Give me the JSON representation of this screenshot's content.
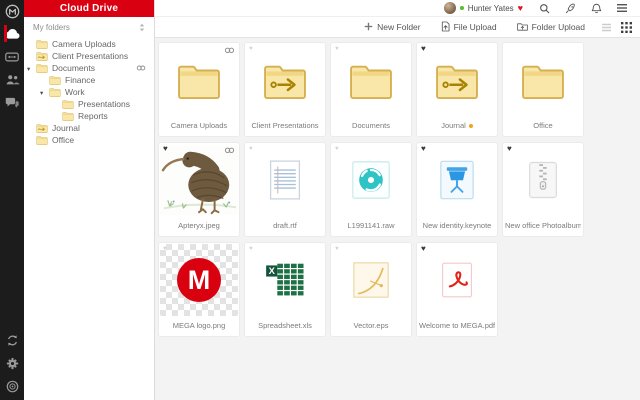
{
  "app": {
    "title": "Cloud Drive"
  },
  "glyphs": {
    "heart": "♥",
    "caret_down": "▾"
  },
  "colors": {
    "brand_red": "#d90012",
    "rail_bg": "#1c1c1c",
    "folder_fill": "#f8e7a9",
    "folder_border": "#d6b050",
    "share_arrow": "#a98200",
    "favourite_filled": "#3a3a3a",
    "favourite_faint": "#d2d2d2",
    "label_dot_orange": "#f5a21d",
    "presence_green": "#54c02c",
    "mega_logo_red": "#d9000f"
  },
  "rail": {
    "top": [
      {
        "name": "mega-logo",
        "active": false
      },
      {
        "name": "cloud-drive",
        "active": true
      },
      {
        "name": "links",
        "active": false
      },
      {
        "name": "contacts",
        "active": false
      },
      {
        "name": "chat",
        "active": false
      }
    ],
    "bottom": [
      {
        "name": "sync",
        "active": false
      },
      {
        "name": "settings",
        "active": false
      },
      {
        "name": "storage",
        "active": false
      }
    ]
  },
  "topbar": {
    "user": "Hunter Yates",
    "presence": "online",
    "badge": "membership-heart",
    "icons": [
      "search",
      "rocket",
      "notifications",
      "menu"
    ]
  },
  "toolbar": {
    "new_folder": "New Folder",
    "file_upload": "File Upload",
    "folder_upload": "Folder Upload",
    "active_view": "grid"
  },
  "sidebar": {
    "header": "My folders",
    "tree": [
      {
        "label": "Camera Uploads",
        "depth": 0,
        "icon": "folder"
      },
      {
        "label": "Client Presentations",
        "depth": 0,
        "icon": "folder-share"
      },
      {
        "label": "Documents",
        "depth": 0,
        "icon": "folder",
        "expanded": true,
        "link": true
      },
      {
        "label": "Finance",
        "depth": 1,
        "icon": "folder"
      },
      {
        "label": "Work",
        "depth": 1,
        "icon": "folder",
        "expanded": true
      },
      {
        "label": "Presentations",
        "depth": 2,
        "icon": "folder"
      },
      {
        "label": "Reports",
        "depth": 2,
        "icon": "folder"
      },
      {
        "label": "Journal",
        "depth": 0,
        "icon": "folder-share"
      },
      {
        "label": "Office",
        "depth": 0,
        "icon": "folder"
      }
    ]
  },
  "grid": {
    "items": [
      {
        "label": "Camera Uploads",
        "icon": "folder",
        "link": true,
        "heart": null,
        "dot": false
      },
      {
        "label": "Client Presentations",
        "icon": "folder-share",
        "link": false,
        "heart": "faint",
        "dot": false
      },
      {
        "label": "Documents",
        "icon": "folder",
        "link": false,
        "heart": "faint",
        "dot": false
      },
      {
        "label": "Journal",
        "icon": "folder-share",
        "link": false,
        "heart": "filled",
        "dot": true
      },
      {
        "label": "Office",
        "icon": "folder",
        "link": false,
        "heart": null,
        "dot": false
      },
      {
        "label": "Apteryx.jpeg",
        "icon": "image-kiwi",
        "link": true,
        "heart": "filled",
        "dot": false
      },
      {
        "label": "draft.rtf",
        "icon": "rtf",
        "link": false,
        "heart": "faint",
        "dot": false
      },
      {
        "label": "L1991141.raw",
        "icon": "raw",
        "link": false,
        "heart": "faint",
        "dot": false
      },
      {
        "label": "New identity.keynote",
        "icon": "keynote",
        "link": false,
        "heart": "filled",
        "dot": false
      },
      {
        "label": "New office Photoalbum.zip",
        "icon": "zip",
        "link": false,
        "heart": "filled",
        "dot": false
      },
      {
        "label": "MEGA logo.png",
        "icon": "mega-png",
        "link": false,
        "heart": "faint",
        "dot": false
      },
      {
        "label": "Spreadsheet.xls",
        "icon": "xls",
        "link": false,
        "heart": "faint",
        "dot": false
      },
      {
        "label": "Vector.eps",
        "icon": "eps",
        "link": false,
        "heart": "faint",
        "dot": false
      },
      {
        "label": "Welcome to MEGA.pdf",
        "icon": "pdf",
        "link": false,
        "heart": "filled",
        "dot": false
      }
    ]
  }
}
